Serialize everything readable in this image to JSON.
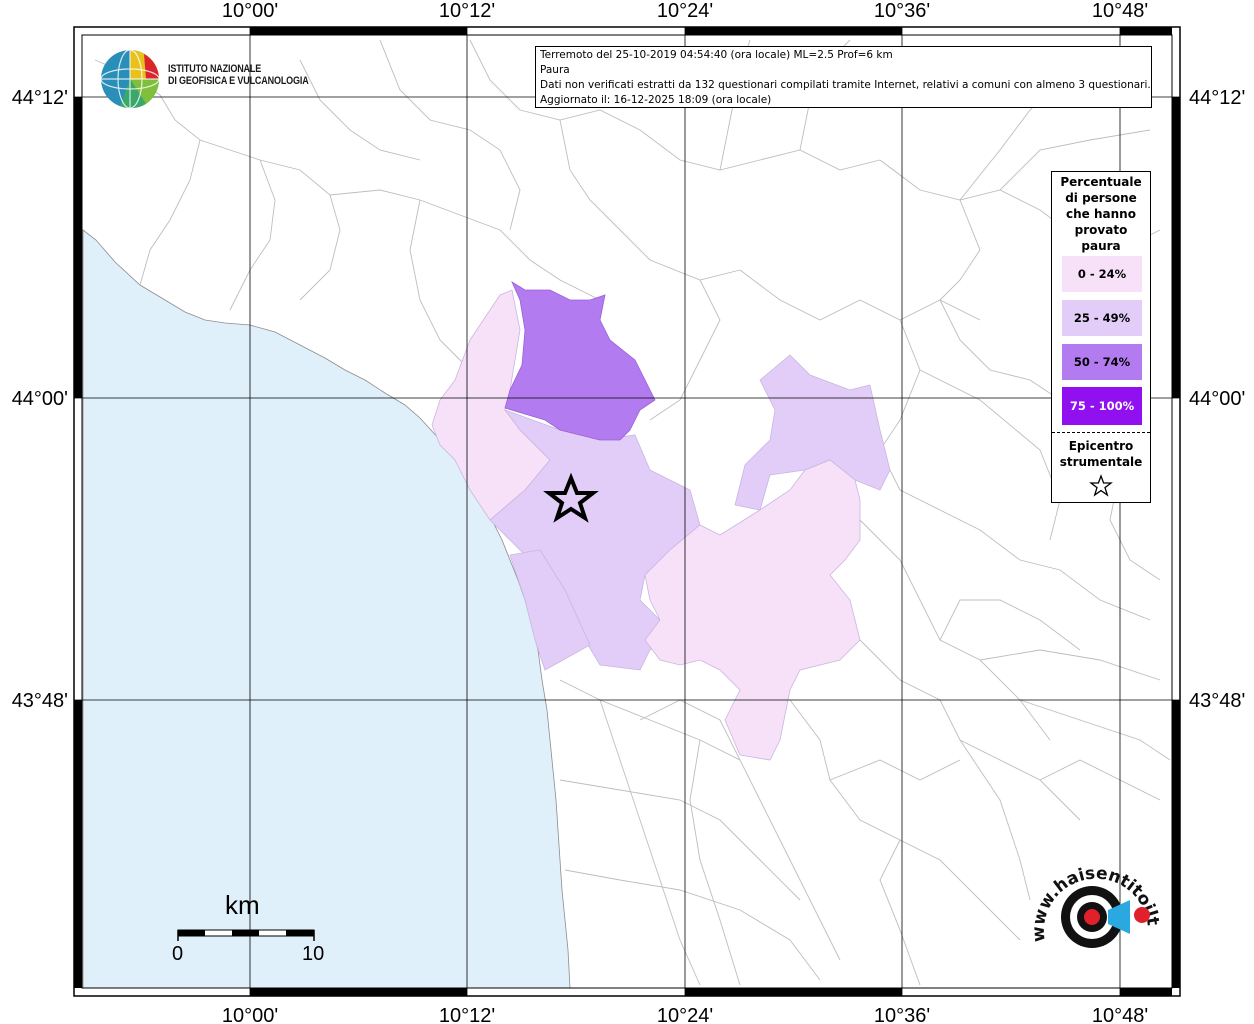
{
  "info": {
    "line1": "Terremoto del 25-10-2019 04:54:40 (ora locale) ML=2.5 Prof=6 km",
    "line2": "Paura",
    "line3": "Dati non verificati estratti da 132 questionari compilati tramite Internet, relativi a comuni con almeno 3 questionari.",
    "line4": "Aggiornato il: 16-12-2025 18:09 (ora locale)"
  },
  "logo": {
    "line1": "ISTITUTO NAZIONALE",
    "line2": "DI GEOFISICA E VULCANOLOGIA"
  },
  "axes": {
    "lon_labels": [
      "10°00'",
      "10°12'",
      "10°24'",
      "10°36'",
      "10°48'"
    ],
    "lat_labels": [
      "44°12'",
      "44°00'",
      "43°48'"
    ]
  },
  "legend": {
    "title": "Percentuale di persone che hanno provato paura",
    "title_lines": [
      "Percentuale",
      "di persone",
      "che hanno",
      "provato",
      "paura"
    ],
    "classes": [
      {
        "label": "0 - 24%",
        "color": "#f7e1f9"
      },
      {
        "label": "25 - 49%",
        "color": "#e1cdf7"
      },
      {
        "label": "50 - 74%",
        "color": "#b37bf0"
      },
      {
        "label": "75 - 100%",
        "color": "#9010f0"
      }
    ],
    "epicenter_lines": [
      "Epicentro",
      "strumentale"
    ]
  },
  "scale": {
    "unit": "km",
    "start": "0",
    "end": "10"
  },
  "watermark": {
    "text": "www.haisentitoilterremoto.it"
  },
  "colors": {
    "sea": "#dff0fb",
    "land": "#ffffff",
    "borders": "#b8b8b8"
  }
}
